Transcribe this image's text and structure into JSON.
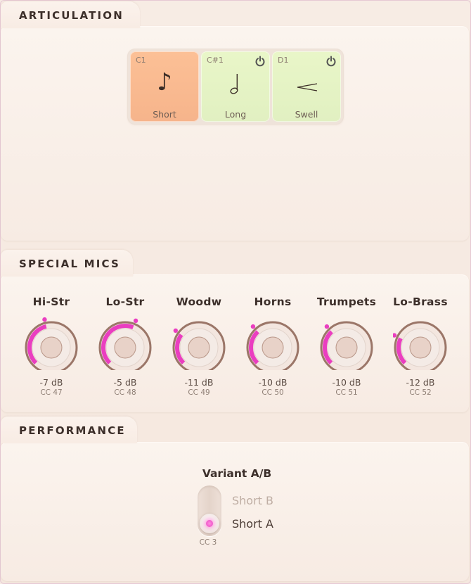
{
  "sections": {
    "articulation": "ARTICULATION",
    "special_mics": "SPECIAL MICS",
    "performance": "PERFORMANCE"
  },
  "articulations": [
    {
      "note": "C1",
      "glyph": "♪",
      "label": "Short",
      "active": true,
      "power": false
    },
    {
      "note": "C#1",
      "glyph": "𝅗𝅥",
      "label": "Long",
      "active": false,
      "power": true
    },
    {
      "note": "D1",
      "glyph": "<",
      "label": "Swell",
      "active": false,
      "power": true
    }
  ],
  "mics": [
    {
      "name": "Hi-Str",
      "value": "-7 dB",
      "cc": "CC 47",
      "level": 0.45
    },
    {
      "name": "Lo-Str",
      "value": "-5 dB",
      "cc": "CC 48",
      "level": 0.58
    },
    {
      "name": "Woodw",
      "value": "-11 dB",
      "cc": "CC 49",
      "level": 0.3
    },
    {
      "name": "Horns",
      "value": "-10 dB",
      "cc": "CC 50",
      "level": 0.34
    },
    {
      "name": "Trumpets",
      "value": "-10 dB",
      "cc": "CC 51",
      "level": 0.34
    },
    {
      "name": "Lo-Brass",
      "value": "-12 dB",
      "cc": "CC 52",
      "level": 0.26
    }
  ],
  "performance": {
    "title": "Variant A/B",
    "option_b": "Short B",
    "option_a": "Short A",
    "selected": "Short A",
    "cc": "CC 3"
  },
  "colors": {
    "accent": "#ea3ec0",
    "active_articulation": "#f8b88e",
    "idle_articulation": "#e5f4c4",
    "knob_rim": "#9b7668"
  }
}
